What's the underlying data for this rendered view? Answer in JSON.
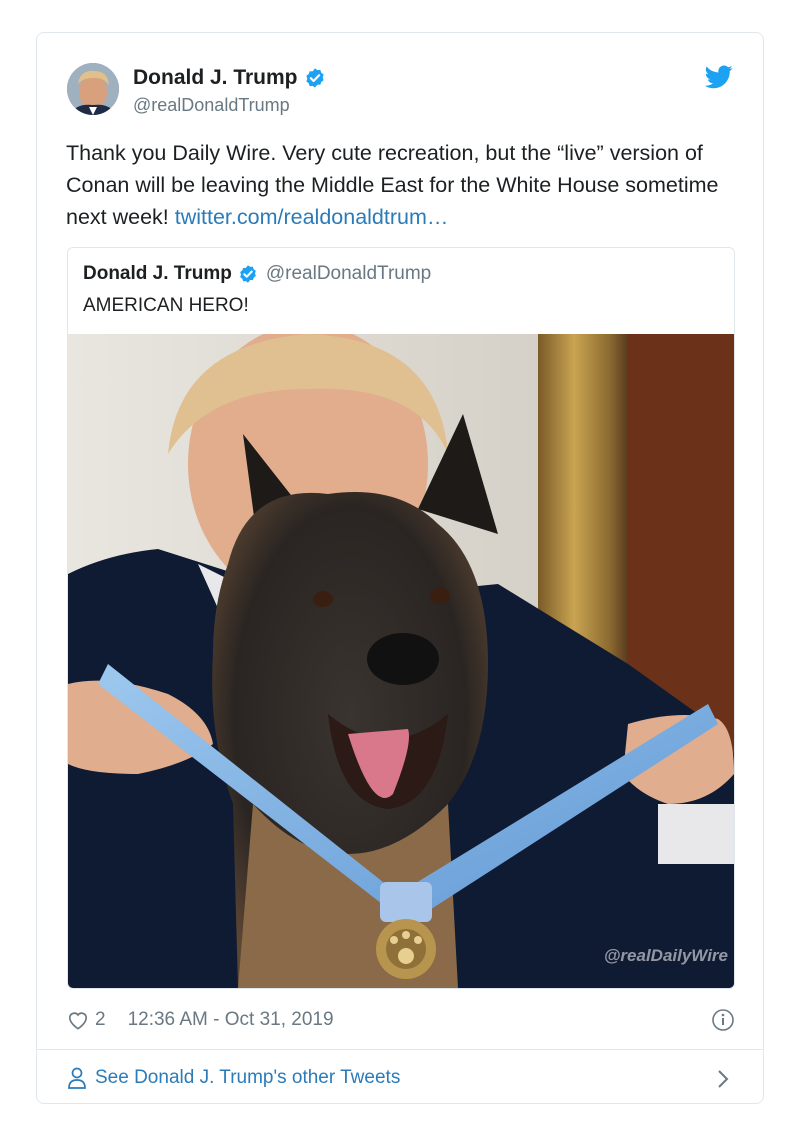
{
  "tweet": {
    "author": {
      "name": "Donald J. Trump",
      "handle": "@realDonaldTrump",
      "verified": true,
      "avatar_icon": "profile-photo"
    },
    "text": "Thank you Daily Wire. Very cute recreation, but the “live” version of Conan will be leaving the Middle East for the White House sometime next week! ",
    "link": "twitter.com/realdonaldtrum…",
    "quoted": {
      "name": "Donald J. Trump",
      "handle": "@realDonaldTrump",
      "text": "AMERICAN HERO!",
      "media_watermark": "@realDailyWire"
    },
    "likes": "2",
    "timestamp": "12:36 AM - Oct 31, 2019",
    "footer": "See Donald J. Trump's other Tweets"
  },
  "colors": {
    "link": "#2b7bb9",
    "twitter_blue": "#1da1f2",
    "muted": "#697882",
    "border": "#e1e8ed"
  }
}
